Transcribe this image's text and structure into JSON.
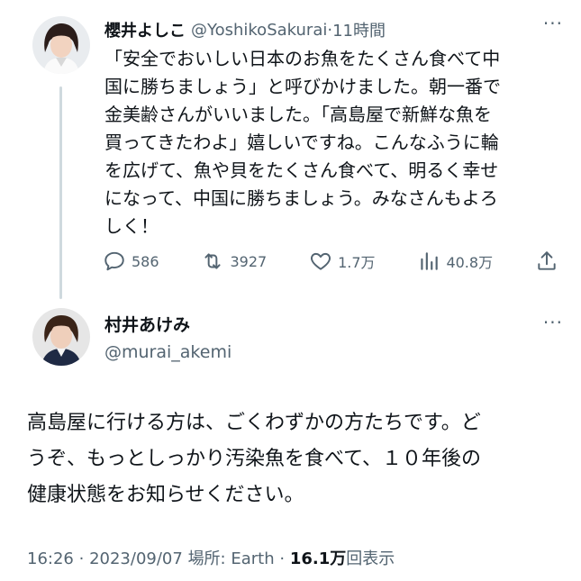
{
  "tweet1": {
    "display_name": "櫻井よしこ",
    "handle": "@YoshikoSakurai",
    "separator": "·",
    "time": "11時間",
    "more_glyph": "···",
    "text": "「安全でおいしい日本のお魚をたくさん食べて中\n国に勝ちましょう」と呼びかけました。朝一番で\n金美齢さんがいいました。「高島屋で新鮮な魚を\n買ってきたわよ」嬉しいですね。こんなふうに輪\nを広げて、魚や貝をたくさん食べて、明るく幸せ\nになって、中国に勝ちましょう。みなさんもよろ\nしく！",
    "actions": {
      "reply": {
        "icon": "reply-icon",
        "count": "586"
      },
      "retweet": {
        "icon": "retweet-icon",
        "count": "3927"
      },
      "like": {
        "icon": "heart-icon",
        "count": "1.7万"
      },
      "views": {
        "icon": "views-chart-icon",
        "count": "40.8万"
      },
      "share": {
        "icon": "share-icon"
      }
    }
  },
  "tweet2": {
    "display_name": "村井あけみ",
    "handle": "@murai_akemi",
    "more_glyph": "···",
    "text": "高島屋に行ける方は、ごくわずかの方たちです。ど\nうぞ、もっとしっかり汚染魚を食べて、１０年後の\n健康状態をお知らせください。",
    "meta": {
      "time": "16:26",
      "sep1": "·",
      "date": "2023/09/07",
      "location": "場所: Earth",
      "sep2": "·",
      "views": "16.1万",
      "views_label": "回表示"
    }
  },
  "colors": {
    "text_primary": "#0f1419",
    "text_secondary": "#536471",
    "thread_line": "#cfd9de"
  }
}
